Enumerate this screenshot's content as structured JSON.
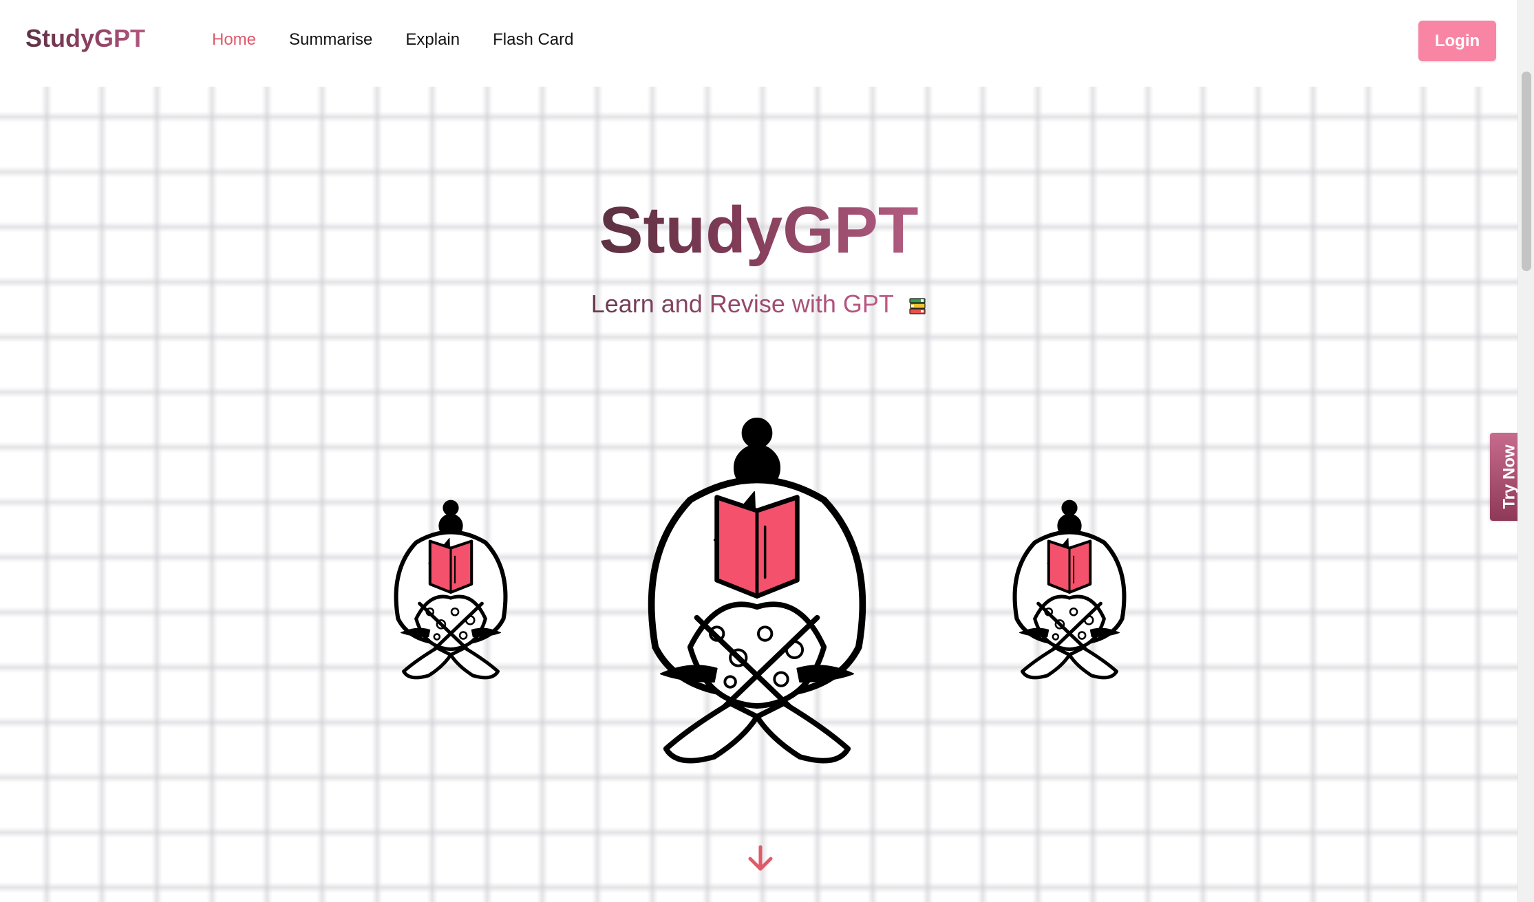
{
  "navbar": {
    "brand": "StudyGPT",
    "links": [
      {
        "label": "Home",
        "active": true
      },
      {
        "label": "Summarise",
        "active": false
      },
      {
        "label": "Explain",
        "active": false
      },
      {
        "label": "Flash Card",
        "active": false
      }
    ],
    "login_label": "Login"
  },
  "hero": {
    "title": "StudyGPT",
    "subtitle": "Learn and Revise with GPT",
    "subtitle_icon": "books-icon"
  },
  "illustrations": [
    {
      "icon": "reading-person-illustration"
    },
    {
      "icon": "reading-person-illustration"
    },
    {
      "icon": "reading-person-illustration"
    }
  ],
  "actions": {
    "scroll_icon": "arrow-down-icon",
    "try_now_label": "Try Now"
  },
  "colors": {
    "accent": "#df5a6b",
    "login_bg": "#f985a5",
    "book": "#f4516c",
    "brand_dark": "#5c3345",
    "brand_light": "#b4587f"
  }
}
